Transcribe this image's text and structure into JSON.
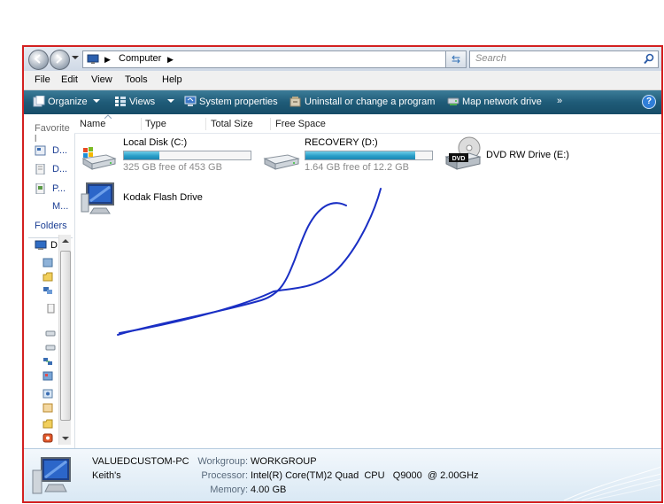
{
  "window": {
    "back_label": "Back",
    "forward_label": "Forward",
    "address_crumb": "Computer",
    "search_placeholder": "Search"
  },
  "menu": [
    "File",
    "Edit",
    "View",
    "Tools",
    "Help"
  ],
  "toolbar": {
    "organize": "Organize",
    "views": "Views",
    "system_properties": "System properties",
    "uninstall": "Uninstall or change a program",
    "map_drive": "Map network drive",
    "overflow": "»",
    "help": "?"
  },
  "nav": {
    "favorites_header": "Favorite l",
    "favorite_links": [
      "D...",
      "D...",
      "P...",
      "M..."
    ],
    "folders_header": "Folders",
    "tree_root": "D"
  },
  "columns": [
    "Name",
    "Type",
    "Total Size",
    "Free Space"
  ],
  "drives": [
    {
      "name": "Local Disk (C:)",
      "free_text": "325 GB free of 453 GB",
      "used_fraction": 0.28,
      "icon": "hard-disk-windows-icon"
    },
    {
      "name": "RECOVERY (D:)",
      "free_text": "1.64 GB free of 12.2 GB",
      "used_fraction": 0.87,
      "icon": "hard-disk-icon"
    },
    {
      "name": "DVD RW Drive (E:)",
      "icon": "dvd-drive-icon",
      "badge": "DVD"
    },
    {
      "name": "Kodak Flash Drive",
      "icon": "computer-monitor-icon"
    }
  ],
  "details": {
    "computer_name": "VALUEDCUSTOM-PC",
    "owner": "Keith's",
    "workgroup_label": "Workgroup:",
    "workgroup_value": "WORKGROUP",
    "processor_label": "Processor:",
    "processor_value": "Intel(R) Core(TM)2 Quad  CPU   Q9000  @ 2.00GHz",
    "memory_label": "Memory:",
    "memory_value": "4.00 GB"
  },
  "colors": {
    "frame_border": "#d32020",
    "toolbar": "#1f5b78",
    "scribble": "#1a2fc4",
    "link": "#1c3f94"
  }
}
